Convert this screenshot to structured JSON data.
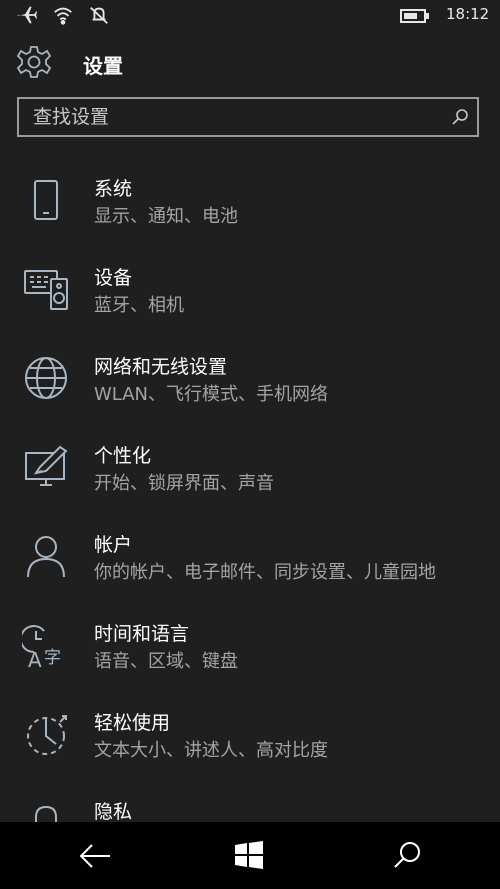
{
  "status": {
    "time": "18:12",
    "icons": [
      "airplane-icon",
      "wifi-icon",
      "quiet-hours-icon",
      "battery-icon"
    ]
  },
  "header": {
    "title": "设置",
    "icon": "gear-icon"
  },
  "search": {
    "placeholder": "查找设置",
    "icon": "search-icon"
  },
  "items": [
    {
      "label": "系统",
      "desc": "显示、通知、电池",
      "icon": "phone-icon"
    },
    {
      "label": "设备",
      "desc": "蓝牙、相机",
      "icon": "devices-icon"
    },
    {
      "label": "网络和无线设置",
      "desc": "WLAN、飞行模式、手机网络",
      "icon": "globe-icon"
    },
    {
      "label": "个性化",
      "desc": "开始、锁屏界面、声音",
      "icon": "personalization-icon"
    },
    {
      "label": "帐户",
      "desc": "你的帐户、电子邮件、同步设置、儿童园地",
      "icon": "person-icon"
    },
    {
      "label": "时间和语言",
      "desc": "语音、区域、键盘",
      "icon": "time-language-icon"
    },
    {
      "label": "轻松使用",
      "desc": "文本大小、讲述人、高对比度",
      "icon": "ease-of-access-icon"
    },
    {
      "label": "隐私",
      "desc": "",
      "icon": "lock-icon"
    }
  ],
  "navbar": {
    "icons": [
      "back-arrow-icon",
      "windows-icon",
      "search-icon"
    ]
  },
  "colors": {
    "background": "#1f1f1f",
    "icon_stroke": "#a7b6c2",
    "secondary_text": "#a3a3a3",
    "navbar": "#000000"
  }
}
